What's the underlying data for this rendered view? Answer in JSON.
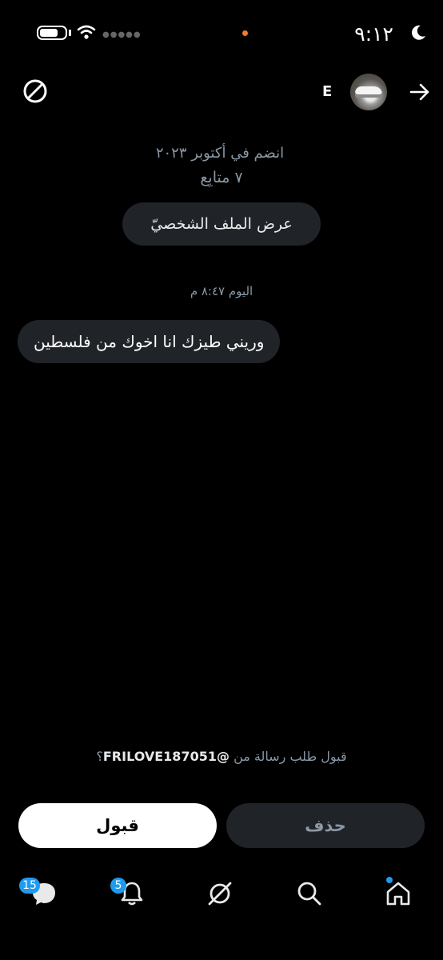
{
  "status_bar": {
    "time": "٩:١٢"
  },
  "header": {
    "name": "E"
  },
  "profile": {
    "joined": "انضم في أكتوبر ٢٠٢٣",
    "followers": "٧ متابِع",
    "view_profile_label": "عرض الملف الشخصيّ"
  },
  "conversation": {
    "timestamp": "اليوم ٨:٤٧ م",
    "message": "وريني طيزك انا اخوك من فلسطين"
  },
  "request": {
    "prompt_prefix": "قبول طلب رسالة من",
    "handle": "@FRILOVE187051",
    "prompt_suffix": "؟",
    "accept_label": "قبول",
    "delete_label": "حذف"
  },
  "nav": {
    "messages_badge": "15",
    "notifications_badge": "5",
    "icons": [
      "messages-icon",
      "notifications-icon",
      "grok-icon",
      "search-icon",
      "home-icon"
    ]
  },
  "colors": {
    "accent": "#1d9bf0",
    "background": "#000000",
    "bubble": "#202327",
    "notification_dot": "#f07b2c"
  }
}
